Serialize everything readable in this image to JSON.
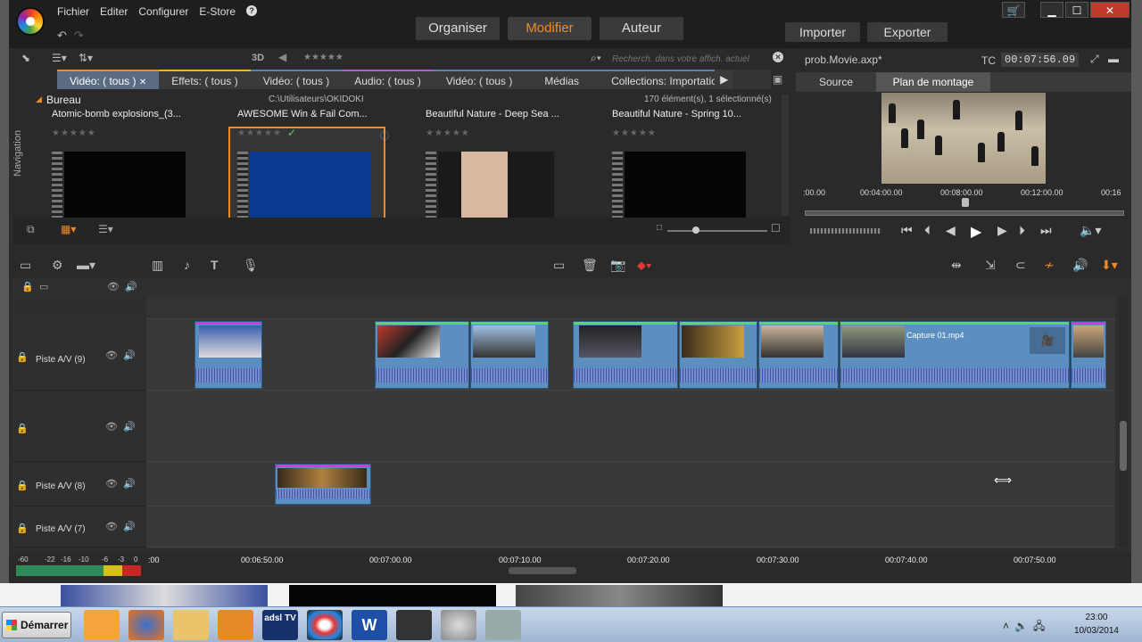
{
  "menu": {
    "items": [
      "Fichier",
      "Editer",
      "Configurer",
      "E-Store"
    ],
    "help": "?"
  },
  "modes": {
    "organize": "Organiser",
    "edit": "Modifier",
    "author": "Auteur"
  },
  "actions": {
    "import": "Importer",
    "export": "Exporter"
  },
  "library": {
    "label_3d": "3D",
    "stars": "★★★★★",
    "search_placeholder": "Recherch. dans votre affich. actuel",
    "tabs": [
      "Vidéo: ( tous )",
      "Effets: ( tous )",
      "Vidéo: ( tous )",
      "Audio: ( tous )",
      "Vidéo: ( tous )",
      "Médias",
      "Collections: Importatio"
    ],
    "nav_label": "Navigation",
    "folder": "Bureau",
    "path": "C:\\Utilisateurs\\OKIDOKI",
    "count": "170 élément(s), 1 sélectionné(s)",
    "items": [
      {
        "title": "Atomic-bomb explosions_(3...",
        "stars": "★★★★★"
      },
      {
        "title": "AWESOME Win & Fail Com...",
        "stars": "★★★★★"
      },
      {
        "title": "Beautiful Nature - Deep Sea ...",
        "stars": "★★★★★"
      },
      {
        "title": "Beautiful Nature - Spring 10...",
        "stars": "★★★★★"
      }
    ]
  },
  "preview": {
    "project": "prob.Movie.axp*",
    "tc_label": "TC",
    "timecode": "00:07:56.09",
    "tabs": {
      "source": "Source",
      "timeline": "Plan de montage"
    },
    "ruler": [
      ":00.00",
      "00:04:00.00",
      "00:08:00.00",
      "00:12:00.00",
      "00:16"
    ]
  },
  "timeline": {
    "tracks": [
      {
        "name": "Piste A/V (9)"
      },
      {
        "name": ""
      },
      {
        "name": "Piste A/V (8)"
      },
      {
        "name": "Piste A/V (7)"
      }
    ],
    "clip_label": "Capture 01.mp4",
    "ruler": [
      ":00",
      "00:06:50.00",
      "00:07:00.00",
      "00:07:10.00",
      "00:07:20.00",
      "00:07:30.00",
      "00:07:40.00",
      "00:07:50.00"
    ],
    "vu_scale": [
      "-60",
      "-22",
      "-16",
      "-10",
      "-6",
      "-3",
      "0"
    ]
  },
  "taskbar": {
    "start": "Démarrer",
    "time": "23:00",
    "date": "10/03/2014",
    "adsl_label": "adsl TV"
  },
  "colors": {
    "accent": "#f08a24",
    "clip": "#5a8fbf",
    "app_bg": "#2b2b2b"
  }
}
